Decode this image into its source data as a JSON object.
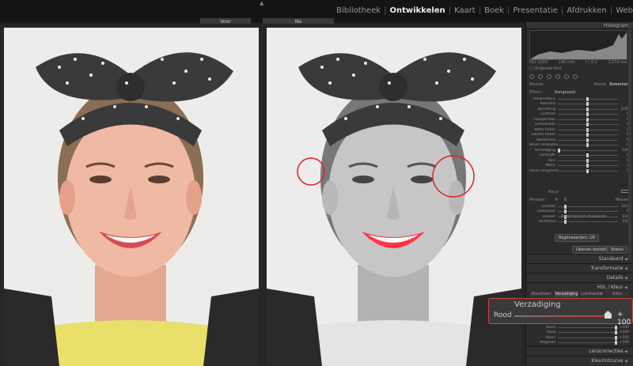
{
  "app": {
    "modules": [
      "Bibliotheek",
      "Ontwikkelen",
      "Kaart",
      "Boek",
      "Presentatie",
      "Afdrukken",
      "Web"
    ],
    "active_module": "Ontwikkelen"
  },
  "compare": {
    "before_label": "Voor",
    "after_label": "Na"
  },
  "panel": {
    "histogram_title": "Histogram",
    "histogram_info": [
      "ISO 2500",
      "140 mm",
      "f / 8,0",
      "1/250 sec"
    ],
    "original_photo": "Originele foto",
    "mask_label": "Masker :",
    "mask_new": "Nieuw",
    "mask_edit": "Bewerken",
    "effect_label": "Effect :",
    "effect_value": "Aangepast",
    "sliders_1": [
      {
        "label": "Temperatuur",
        "value": ""
      },
      {
        "label": "Kleurtint",
        "value": ""
      },
      {
        "label": "Belichting",
        "value": "0,00"
      },
      {
        "label": "Contrast",
        "value": "0"
      },
      {
        "label": "Hooglichten",
        "value": "0"
      },
      {
        "label": "Schaduwen",
        "value": "0"
      },
      {
        "label": "Witte tinten",
        "value": "0"
      },
      {
        "label": "Zwarte tinten",
        "value": "0"
      },
      {
        "label": "Helderheid",
        "value": "0"
      },
      {
        "label": "Nevel verwijderen",
        "value": "0"
      },
      {
        "label": "Verzadiging",
        "value": "-100"
      },
      {
        "label": "Scherpte",
        "value": "0"
      },
      {
        "label": "Ruis",
        "value": "0"
      },
      {
        "label": "Moiré",
        "value": "0"
      },
      {
        "label": "Rand verwijderen",
        "value": "0"
      }
    ],
    "color_label": "Kleur",
    "brush_label": "Penseel :",
    "brush_a": "A",
    "brush_b": "B",
    "brush_erase": "Wissen",
    "sliders_2": [
      {
        "label": "Grootte",
        "value": "16,0"
      },
      {
        "label": "Doezelaar",
        "value": "0"
      },
      {
        "label": "Stroom",
        "value": "100"
      },
      {
        "label": "Dichtheid",
        "value": "100"
      }
    ],
    "auto_mask": "Automatisch maskeren",
    "reset_button": "Beginwaarden",
    "reset_value": "Uit",
    "close_button": "Openen toolset",
    "status_button": "Status",
    "sections": [
      "Standaard",
      "Transformatie",
      "Details",
      "HSL / Kleur",
      "Lenscorrecties",
      "Kleurintcurve"
    ],
    "hsl_tabs": [
      "Kleurtoon",
      "Verzadiging",
      "Luminantie",
      "Alles"
    ],
    "hsl_rows": [
      {
        "label": "Paars",
        "value": "+100"
      },
      {
        "label": "Rood",
        "value": "+100"
      },
      {
        "label": "Paars",
        "value": "+100"
      },
      {
        "label": "Magenta",
        "value": "+100"
      }
    ]
  },
  "callout": {
    "title": "Verzadiging",
    "label": "Rood",
    "value": "+ 100",
    "fraction": 0.95
  },
  "colors": {
    "accent_red": "#cc3333",
    "panel_bg": "#2b2b2b"
  }
}
